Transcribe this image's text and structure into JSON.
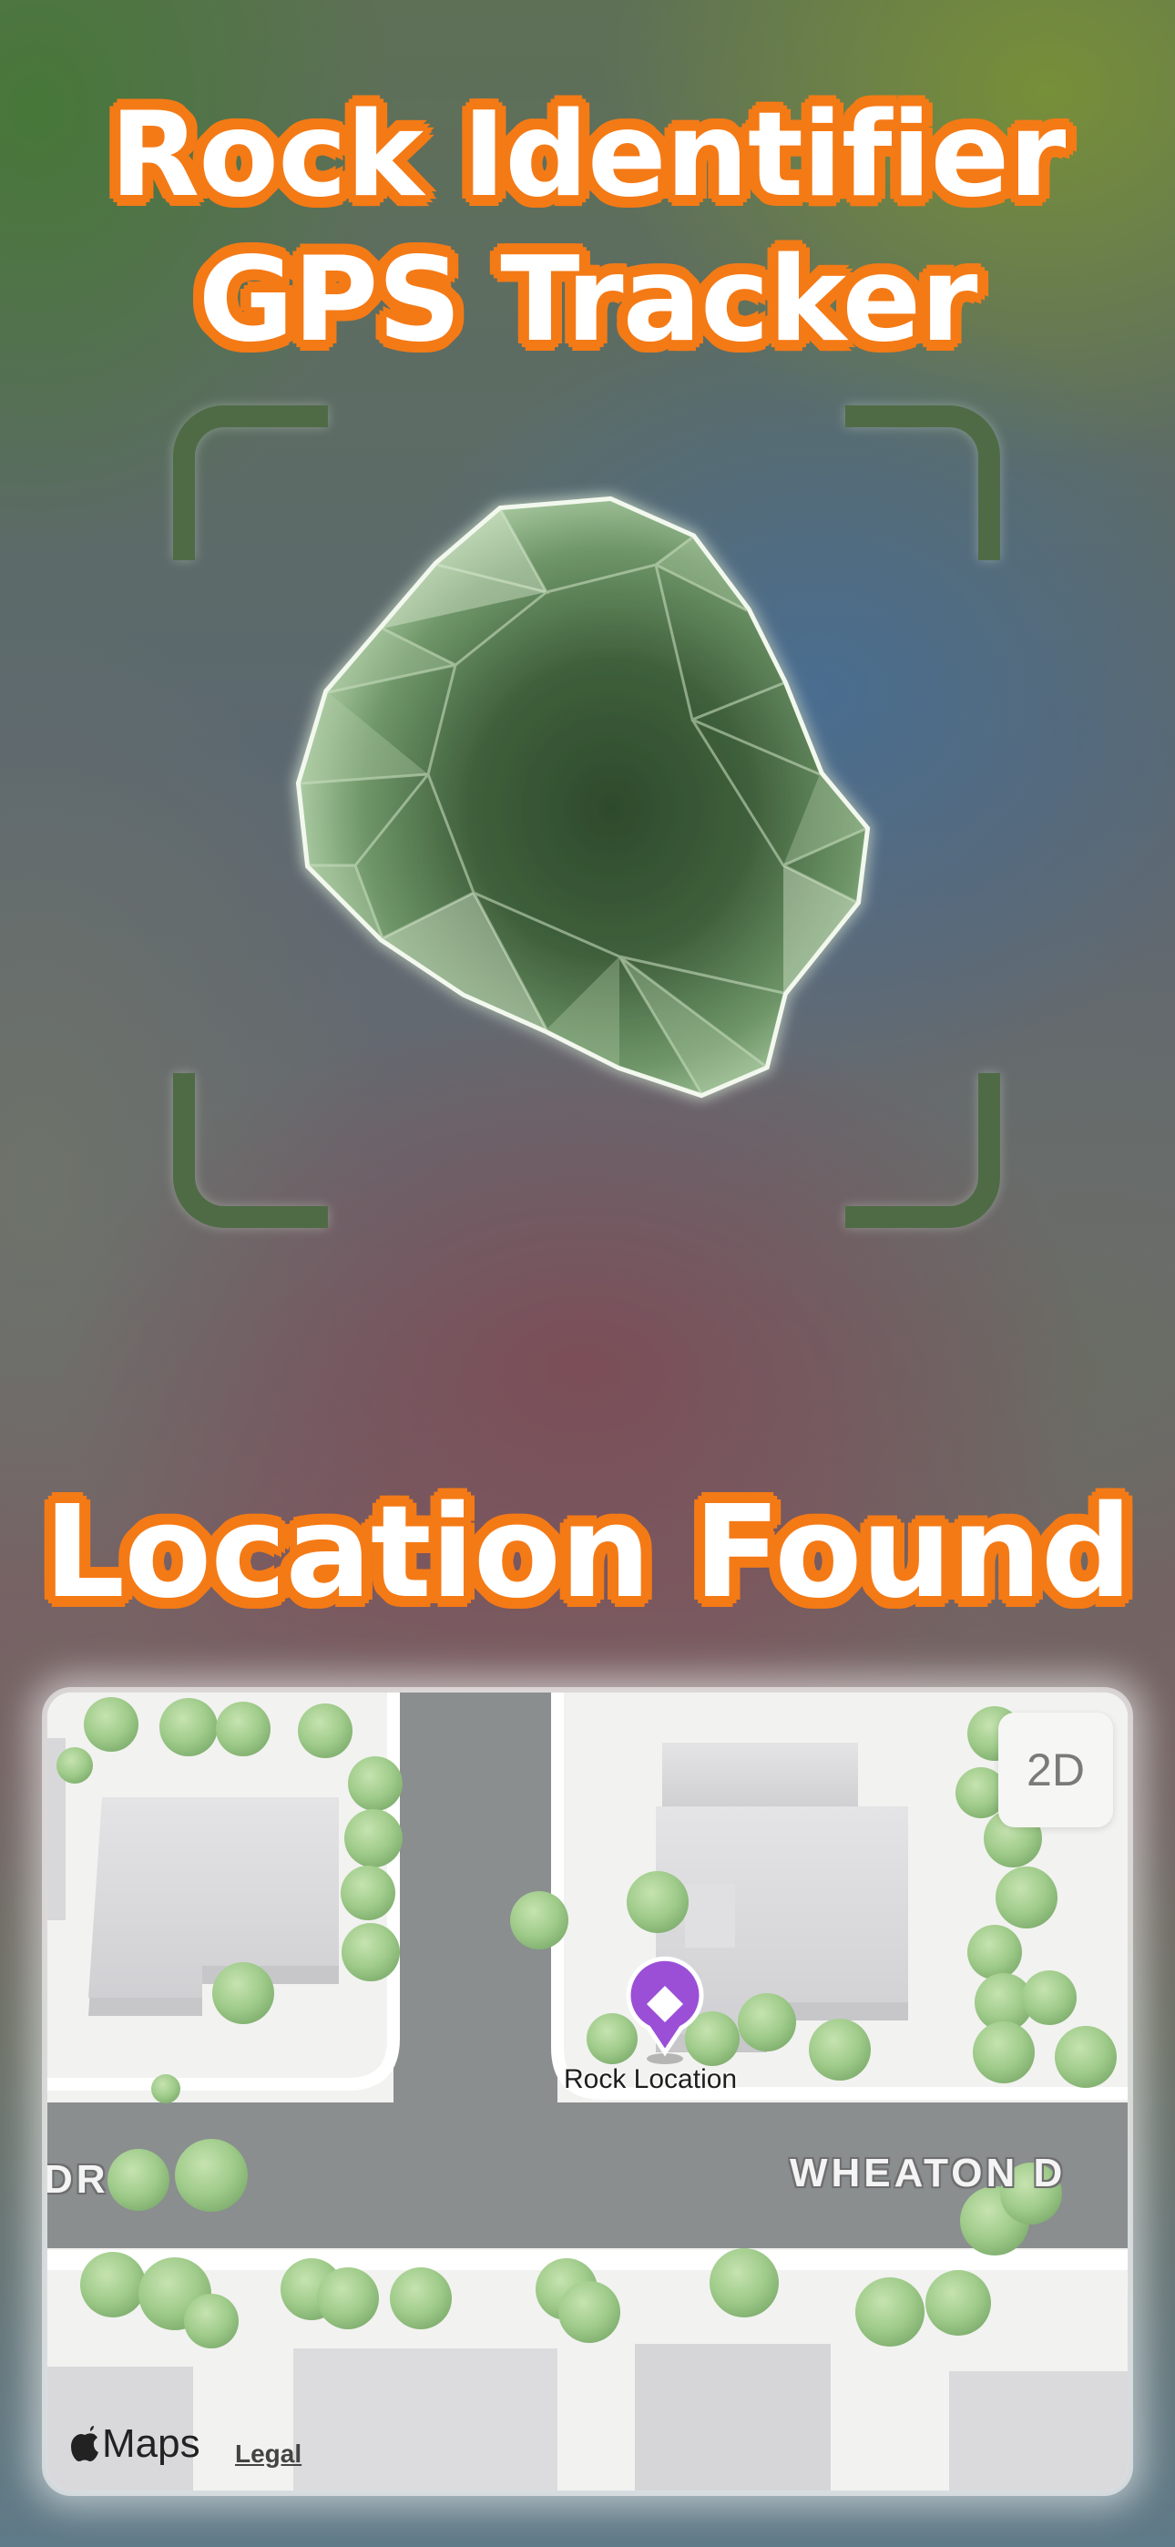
{
  "headline": {
    "line1": "Rock Identifier",
    "line2": "GPS Tracker",
    "section": "Location Found"
  },
  "colors": {
    "headline_fill": "#ffffff",
    "headline_outline": "#f47a16",
    "scan_corners": "#4f6b46",
    "rock_green": "#7fa57a",
    "pin_purple": "#9b4fd6"
  },
  "scanner": {
    "subject_icon": "rock-icon",
    "frame_icon": "scan-frame-icon"
  },
  "map": {
    "view_toggle_label": "2D",
    "streets": [
      "DR",
      "WHEATON D"
    ],
    "pin": {
      "label": "Rock Location",
      "icon": "map-pin-diamond-icon"
    },
    "attribution": {
      "brand": "Maps",
      "brand_icon": "apple-logo-icon",
      "legal": "Legal"
    }
  }
}
